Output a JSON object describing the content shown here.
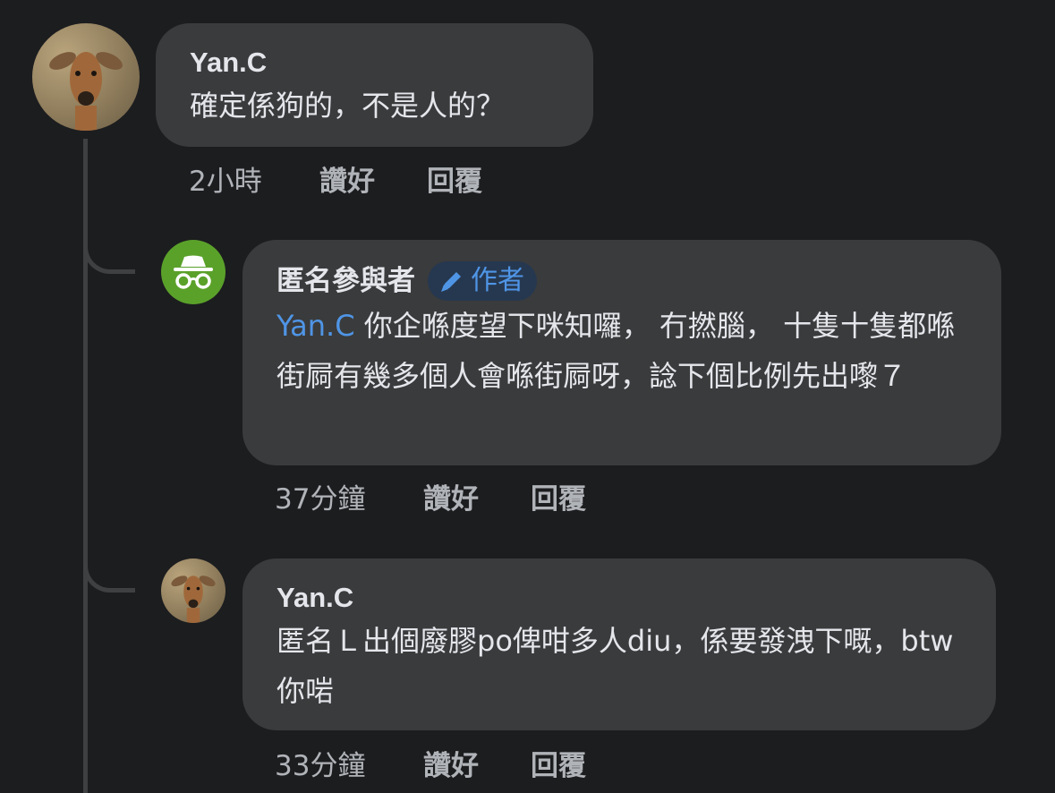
{
  "comments": [
    {
      "author": "Yan.C",
      "text": "確定係狗的，不是人的？",
      "time": "2小時",
      "like_label": "讚好",
      "reply_label": "回覆"
    },
    {
      "author": "匿名參與者",
      "badge": "作者",
      "mention": "Yan.C",
      "text": " 你企喺度望下咪知囉， 冇撚腦， 十隻十隻都喺街屙有幾多個人會喺街屙呀，諗下個比例先出嚟７",
      "time": "37分鐘",
      "like_label": "讚好",
      "reply_label": "回覆"
    },
    {
      "author": "Yan.C",
      "text": "匿名Ｌ出個廢膠po俾咁多人diu，係要發洩下嘅，btw 你啱",
      "time": "33分鐘",
      "like_label": "讚好",
      "reply_label": "回覆"
    }
  ],
  "colors": {
    "background": "#1c1d1f",
    "bubble": "#3a3b3c",
    "mention": "#4f95e6",
    "anon_avatar": "#5aa12a"
  }
}
